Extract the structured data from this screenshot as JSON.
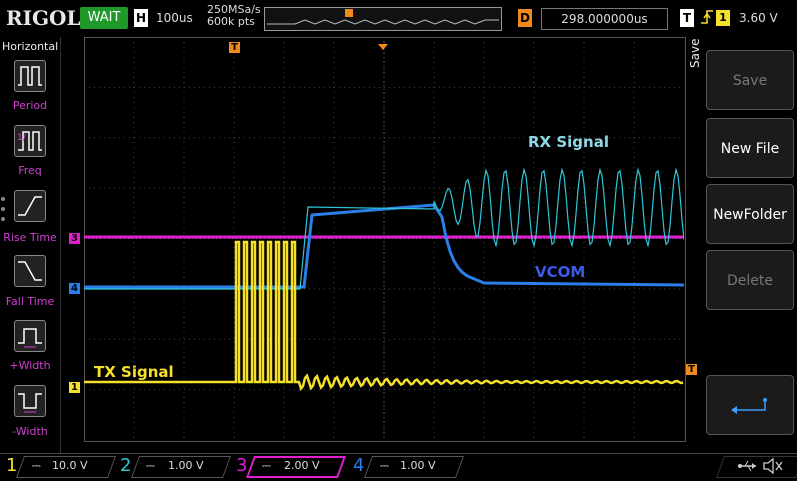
{
  "header": {
    "logo": "RIGOL",
    "run_state": "WAIT",
    "h_label": "H",
    "timebase": "100us",
    "sample_rate": "250MSa/s",
    "memory_depth": "600k pts",
    "trigger_pos_marker": "T",
    "delay_label": "D",
    "delay_value": "298.000000us",
    "trigger_label": "T",
    "trigger_source": "1",
    "trigger_level": "3.60 V"
  },
  "left_menu": {
    "title": "Horizontal",
    "items": [
      {
        "label": "Period",
        "icon": "period-icon"
      },
      {
        "label": "Freq",
        "icon": "freq-icon"
      },
      {
        "label": "Rise Time",
        "icon": "rise-time-icon"
      },
      {
        "label": "Fall Time",
        "icon": "fall-time-icon"
      },
      {
        "label": "+Width",
        "icon": "positive-width-icon"
      },
      {
        "label": "-Width",
        "icon": "negative-width-icon"
      }
    ]
  },
  "right_menu": {
    "title": "Save",
    "buttons": [
      {
        "label": "Save",
        "enabled": false
      },
      {
        "label": "New File",
        "enabled": true
      },
      {
        "label": "NewFolder",
        "enabled": true
      },
      {
        "label": "Delete",
        "enabled": false
      }
    ],
    "return_icon": "return-arrow-icon"
  },
  "waveform_labels": {
    "rx": "RX Signal",
    "vcom": "VCOM",
    "tx": "TX Signal"
  },
  "channels": [
    {
      "number": "1",
      "scale": "10.0 V",
      "color": "#f5e12a"
    },
    {
      "number": "2",
      "scale": "1.00 V",
      "color": "#2ec8d8"
    },
    {
      "number": "3",
      "scale": "2.00 V",
      "color": "#e020d0"
    },
    {
      "number": "4",
      "scale": "1.00 V",
      "color": "#2a7fe8"
    }
  ],
  "markers": {
    "ch3": "3",
    "ch4": "4",
    "ch1": "1",
    "trig": "T"
  },
  "colors": {
    "rx_label": "#8fd8e8",
    "vcom_label": "#3a5ce8",
    "tx_label": "#f5e12a",
    "orange": "#f08a1a"
  },
  "status_icons": [
    "usb-icon",
    "speaker-muted-icon"
  ]
}
